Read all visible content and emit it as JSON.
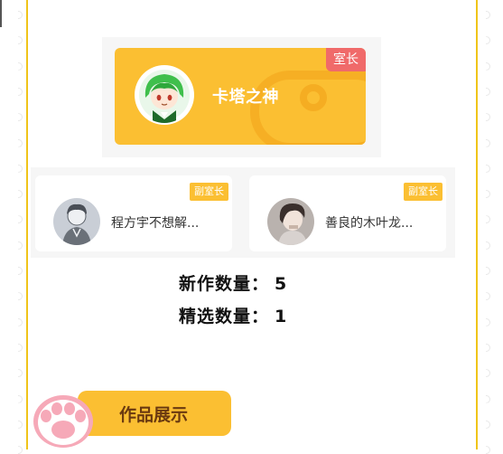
{
  "owner": {
    "badge": "室长",
    "name": "卡塔之神",
    "avatar_icon": "anime-green-hair-avatar"
  },
  "deputies": [
    {
      "badge": "副室长",
      "name": "程方宇不想解...",
      "avatar_icon": "sketch-portrait-avatar"
    },
    {
      "badge": "副室长",
      "name": "善良的木叶龙...",
      "avatar_icon": "dark-hair-portrait-avatar"
    }
  ],
  "stats": {
    "new_works_label": "新作数量：",
    "new_works_value": "5",
    "featured_label": "精选数量：",
    "featured_value": "1"
  },
  "works_button": {
    "label": "作品展示",
    "icon": "paw-icon"
  },
  "colors": {
    "accent": "#fbbf32",
    "owner_badge": "#f06a6a",
    "frame": "#f0c419",
    "button_text": "#6b3a10"
  }
}
